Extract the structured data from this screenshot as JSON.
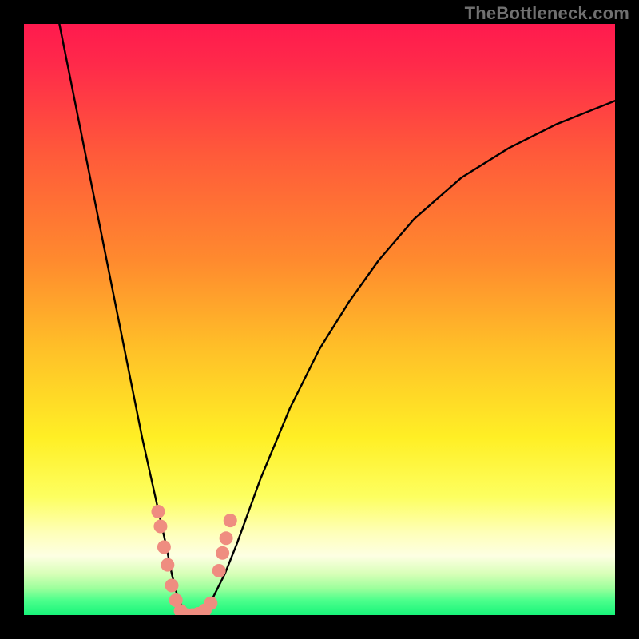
{
  "watermark": "TheBottleneck.com",
  "colors": {
    "frame": "#000000",
    "watermark": "#707070",
    "curve": "#000000",
    "marker_fill": "#ef8d80",
    "marker_stroke": "#d06a5e",
    "gradient_stops": [
      {
        "offset": 0,
        "color": "#ff1a4e"
      },
      {
        "offset": 0.07,
        "color": "#ff2a4a"
      },
      {
        "offset": 0.22,
        "color": "#ff5a3a"
      },
      {
        "offset": 0.4,
        "color": "#ff8a2e"
      },
      {
        "offset": 0.55,
        "color": "#ffc028"
      },
      {
        "offset": 0.7,
        "color": "#ffef25"
      },
      {
        "offset": 0.8,
        "color": "#fdff60"
      },
      {
        "offset": 0.86,
        "color": "#feffb8"
      },
      {
        "offset": 0.9,
        "color": "#fdffe3"
      },
      {
        "offset": 0.93,
        "color": "#d8ffb8"
      },
      {
        "offset": 0.955,
        "color": "#9cff9c"
      },
      {
        "offset": 0.975,
        "color": "#4dff8c"
      },
      {
        "offset": 1.0,
        "color": "#18f47a"
      }
    ]
  },
  "chart_data": {
    "type": "line",
    "title": "",
    "xlabel": "",
    "ylabel": "",
    "xlim": [
      0,
      100
    ],
    "ylim": [
      0,
      100
    ],
    "note": "Single bottleneck curve with minimum near x≈28. Values read off curve (0=bottom/green, 100=top/red).",
    "series": [
      {
        "name": "bottleneck-curve",
        "x": [
          6,
          10,
          14,
          18,
          20,
          22,
          24,
          25,
          26,
          27,
          28,
          29,
          30,
          31,
          32,
          33,
          34,
          36,
          40,
          45,
          50,
          55,
          60,
          66,
          74,
          82,
          90,
          100
        ],
        "values": [
          100,
          80,
          60,
          40,
          30,
          21,
          12,
          7,
          3,
          1,
          0,
          0,
          1,
          2,
          3,
          5,
          7,
          12,
          23,
          35,
          45,
          53,
          60,
          67,
          74,
          79,
          83,
          87
        ]
      }
    ],
    "markers": {
      "name": "highlighted-points",
      "note": "Salmon dots clustered near the curve minimum.",
      "points": [
        {
          "x": 22.7,
          "y": 17.5
        },
        {
          "x": 23.1,
          "y": 15.0
        },
        {
          "x": 23.7,
          "y": 11.5
        },
        {
          "x": 24.3,
          "y": 8.5
        },
        {
          "x": 25.0,
          "y": 5.0
        },
        {
          "x": 25.7,
          "y": 2.5
        },
        {
          "x": 26.5,
          "y": 0.7
        },
        {
          "x": 27.5,
          "y": 0.0
        },
        {
          "x": 28.5,
          "y": 0.0
        },
        {
          "x": 29.5,
          "y": 0.2
        },
        {
          "x": 30.6,
          "y": 0.8
        },
        {
          "x": 31.6,
          "y": 2.0
        },
        {
          "x": 33.0,
          "y": 7.5
        },
        {
          "x": 33.6,
          "y": 10.5
        },
        {
          "x": 34.2,
          "y": 13.0
        },
        {
          "x": 34.9,
          "y": 16.0
        }
      ]
    }
  }
}
